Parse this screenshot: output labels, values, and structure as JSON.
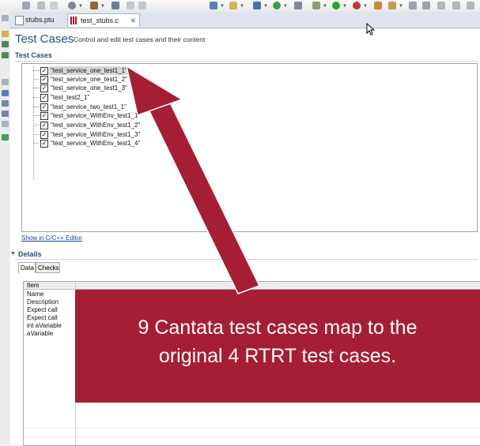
{
  "tabs": [
    {
      "label": "stubs.ptu"
    },
    {
      "label": "test_stubs.c"
    }
  ],
  "editor": {
    "title": "Test Cases",
    "description": "Control and edit test cases and their content",
    "section_title": "Test Cases",
    "test_cases": [
      "\"test_service_one_test1_1\"",
      "\"test_service_one_test1_2\"",
      "\"test_service_one_test1_3\"",
      "\"test_test2_1\"",
      "\"test_service_two_test1_1\"",
      "\"test_service_WithEnv_test1_1\"",
      "\"test_service_WithEnv_test1_2\"",
      "\"test_service_WithEnv_test1_3\"",
      "\"test_service_WithEnv_test1_4\""
    ],
    "show_link": "Show in C/C++ Editor"
  },
  "details": {
    "title": "Details",
    "tabs": [
      "Data",
      "Checks"
    ],
    "column_header": "Item",
    "items": [
      "Name",
      "Description",
      "Expect call",
      "Expect call",
      "int aVariable",
      "aVariable"
    ]
  },
  "callout": {
    "line1": "9 Cantata test cases map to the",
    "line2": "original 4 RTRT test cases."
  },
  "colors": {
    "callout_bg": "#a61e33",
    "title_blue": "#2a4e7d"
  }
}
